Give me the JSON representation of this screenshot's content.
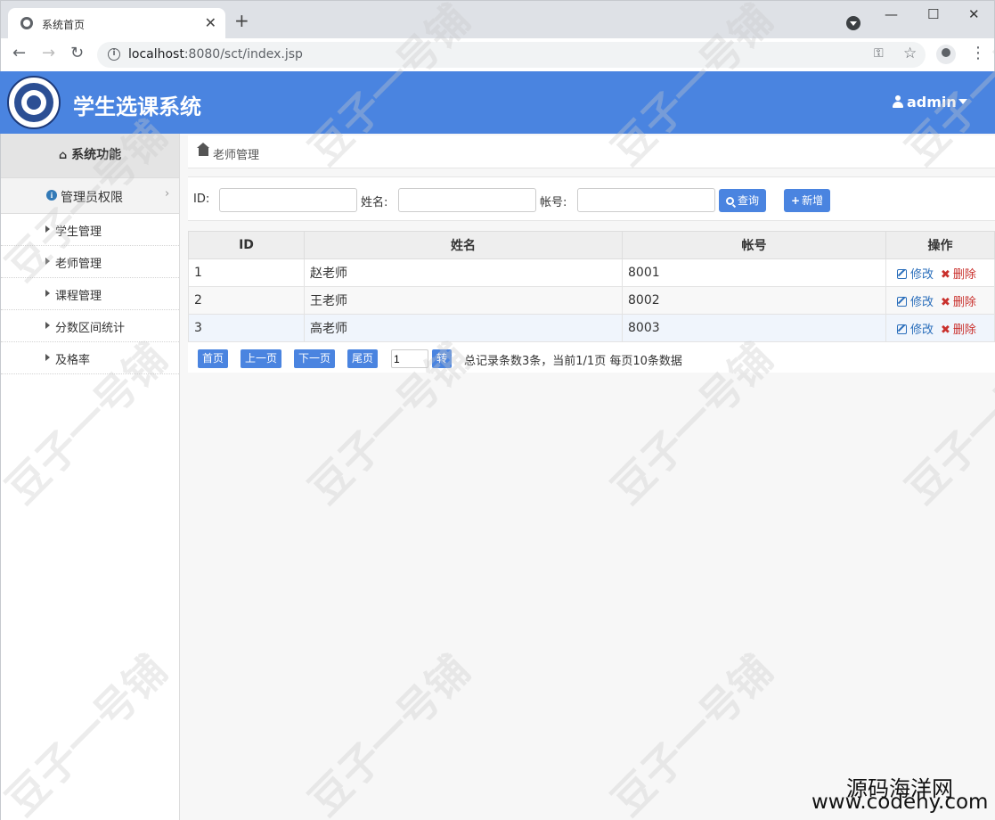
{
  "browser": {
    "tab_title": "系统首页",
    "url_host": "localhost",
    "url_path": ":8080/sct/index.jsp"
  },
  "header": {
    "app_title": "学生选课系统",
    "user": "admin"
  },
  "sidebar": {
    "heading": "系统功能",
    "group": "管理员权限",
    "items": [
      {
        "label": "学生管理"
      },
      {
        "label": "老师管理"
      },
      {
        "label": "课程管理"
      },
      {
        "label": "分数区间统计"
      },
      {
        "label": "及格率"
      }
    ]
  },
  "breadcrumb": {
    "current": "老师管理"
  },
  "search": {
    "id_label": "ID:",
    "name_label": "姓名:",
    "account_label": "帐号:",
    "id_value": "",
    "name_value": "",
    "account_value": "",
    "query_button": "查询",
    "add_button": "新增"
  },
  "table": {
    "columns": [
      "ID",
      "姓名",
      "帐号",
      "操作"
    ],
    "rows": [
      {
        "id": "1",
        "name": "赵老师",
        "account": "8001"
      },
      {
        "id": "2",
        "name": "王老师",
        "account": "8002"
      },
      {
        "id": "3",
        "name": "高老师",
        "account": "8003"
      }
    ],
    "edit_label": "修改",
    "delete_label": "删除"
  },
  "pager": {
    "first": "首页",
    "prev": "上一页",
    "next": "下一页",
    "last": "尾页",
    "page_input": "1",
    "go": "转",
    "info": "总记录条数3条，当前1/1页 每页10条数据"
  },
  "watermark": {
    "text": "豆子一号铺",
    "brand_cn": "源码海洋网",
    "brand_url": "www.codehy.com"
  },
  "colors": {
    "accent": "#4a84e0",
    "link": "#2a6ebb",
    "danger": "#c9302c"
  }
}
